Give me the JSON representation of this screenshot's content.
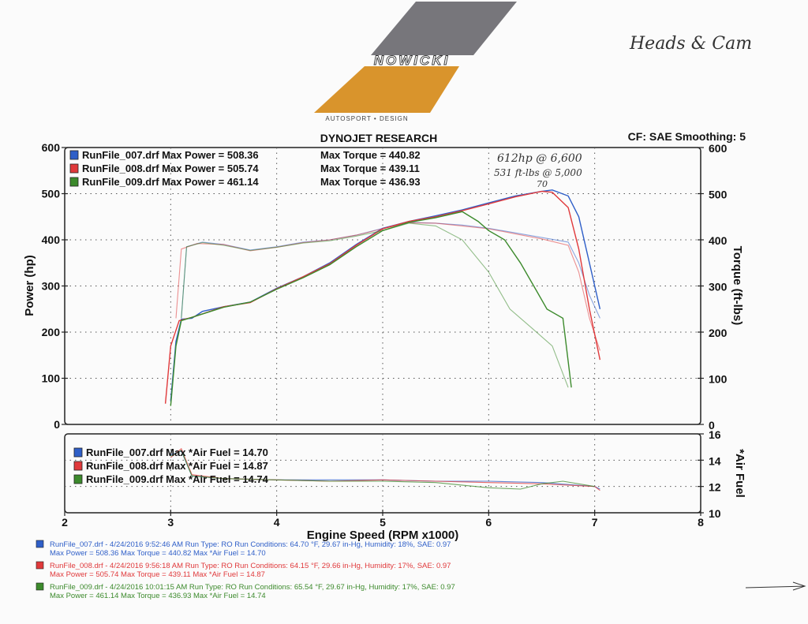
{
  "logo": {
    "brand": "NOWICKI",
    "tagline": "AUTOSPORT • DESIGN",
    "colors": {
      "gray": "#77767b",
      "orange": "#d9942c"
    }
  },
  "handwritten": {
    "top_right": "Heads & Cam",
    "note_line1": "612hp @ 6,600",
    "note_line2": "531 ft-lbs @ 5,000",
    "note_line3": "70"
  },
  "chart_data": {
    "type": "line",
    "title": "DYNOJET RESEARCH",
    "subtitle": "CF: SAE  Smoothing: 5",
    "xlabel": "Engine Speed (RPM x1000)",
    "ylabel_left": "Power (hp)",
    "ylabel_right": "Torque (ft-lbs)",
    "ylabel_lower": "*Air Fuel",
    "xlim": [
      2,
      8
    ],
    "ylim_upper": [
      0,
      600
    ],
    "ylim_lower": [
      10,
      16
    ],
    "x_ticks": [
      "2",
      "3",
      "4",
      "5",
      "6",
      "7",
      "8"
    ],
    "y_ticks_left": [
      "0",
      "100",
      "200",
      "300",
      "400",
      "500",
      "600"
    ],
    "y_ticks_right": [
      "0",
      "100",
      "200",
      "300",
      "400",
      "500",
      "600"
    ],
    "y_ticks_lower": [
      "10",
      "12",
      "14",
      "16"
    ],
    "grid": true,
    "legend_upper": [
      {
        "label": "RunFile_007.drf Max Power = 508.36",
        "torque": "Max Torque = 440.82",
        "color": "#2f5fc8"
      },
      {
        "label": "RunFile_008.drf Max Power = 505.74",
        "torque": "Max Torque = 439.11",
        "color": "#e0393b"
      },
      {
        "label": "RunFile_009.drf Max Power = 461.14",
        "torque": "Max Torque = 436.93",
        "color": "#3c8a2c"
      }
    ],
    "legend_lower": [
      {
        "label": "RunFile_007.drf Max *Air Fuel = 14.70",
        "color": "#2f5fc8"
      },
      {
        "label": "RunFile_008.drf Max *Air Fuel = 14.87",
        "color": "#e0393b"
      },
      {
        "label": "RunFile_009.drf Max *Air Fuel = 14.74",
        "color": "#3c8a2c"
      }
    ],
    "series": [
      {
        "name": "RunFile_007.drf",
        "color": "#2f5fc8",
        "power": [
          [
            3.0,
            50
          ],
          [
            3.05,
            180
          ],
          [
            3.1,
            228
          ],
          [
            3.2,
            230
          ],
          [
            3.3,
            245
          ],
          [
            3.5,
            255
          ],
          [
            3.75,
            265
          ],
          [
            4.0,
            295
          ],
          [
            4.25,
            320
          ],
          [
            4.5,
            350
          ],
          [
            4.75,
            390
          ],
          [
            5.0,
            425
          ],
          [
            5.25,
            440
          ],
          [
            5.5,
            452
          ],
          [
            5.75,
            465
          ],
          [
            6.0,
            480
          ],
          [
            6.25,
            495
          ],
          [
            6.5,
            505
          ],
          [
            6.6,
            508
          ],
          [
            6.75,
            495
          ],
          [
            6.85,
            450
          ],
          [
            6.95,
            350
          ],
          [
            7.05,
            250
          ]
        ],
        "torque": [
          [
            3.1,
            230
          ],
          [
            3.15,
            385
          ],
          [
            3.3,
            395
          ],
          [
            3.5,
            390
          ],
          [
            3.75,
            378
          ],
          [
            4.0,
            385
          ],
          [
            4.25,
            395
          ],
          [
            4.5,
            400
          ],
          [
            4.75,
            410
          ],
          [
            5.0,
            425
          ],
          [
            5.25,
            438
          ],
          [
            5.5,
            436
          ],
          [
            5.75,
            432
          ],
          [
            6.0,
            425
          ],
          [
            6.25,
            415
          ],
          [
            6.5,
            405
          ],
          [
            6.75,
            395
          ],
          [
            6.85,
            350
          ],
          [
            6.95,
            280
          ],
          [
            7.05,
            230
          ]
        ],
        "air_fuel": [
          [
            3.0,
            14.4
          ],
          [
            3.1,
            14.7
          ],
          [
            3.2,
            12.8
          ],
          [
            3.5,
            12.6
          ],
          [
            4.0,
            12.5
          ],
          [
            4.5,
            12.5
          ],
          [
            5.0,
            12.5
          ],
          [
            5.5,
            12.4
          ],
          [
            6.0,
            12.4
          ],
          [
            6.5,
            12.3
          ],
          [
            7.0,
            12.0
          ],
          [
            7.05,
            11.8
          ]
        ]
      },
      {
        "name": "RunFile_008.drf",
        "color": "#e0393b",
        "power": [
          [
            2.95,
            45
          ],
          [
            3.0,
            170
          ],
          [
            3.08,
            225
          ],
          [
            3.2,
            232
          ],
          [
            3.5,
            255
          ],
          [
            3.75,
            264
          ],
          [
            4.0,
            294
          ],
          [
            4.25,
            320
          ],
          [
            4.5,
            348
          ],
          [
            4.75,
            388
          ],
          [
            5.0,
            424
          ],
          [
            5.25,
            440
          ],
          [
            5.5,
            450
          ],
          [
            5.75,
            463
          ],
          [
            6.0,
            478
          ],
          [
            6.25,
            493
          ],
          [
            6.5,
            505
          ],
          [
            6.6,
            503
          ],
          [
            6.75,
            470
          ],
          [
            6.85,
            380
          ],
          [
            6.95,
            250
          ],
          [
            7.05,
            140
          ]
        ],
        "torque": [
          [
            3.05,
            230
          ],
          [
            3.1,
            380
          ],
          [
            3.25,
            392
          ],
          [
            3.5,
            390
          ],
          [
            3.75,
            376
          ],
          [
            4.0,
            384
          ],
          [
            4.25,
            394
          ],
          [
            4.5,
            400
          ],
          [
            4.75,
            410
          ],
          [
            5.0,
            424
          ],
          [
            5.25,
            437
          ],
          [
            5.5,
            436
          ],
          [
            5.75,
            430
          ],
          [
            6.0,
            424
          ],
          [
            6.25,
            413
          ],
          [
            6.5,
            402
          ],
          [
            6.75,
            388
          ],
          [
            6.85,
            330
          ],
          [
            6.95,
            230
          ],
          [
            7.05,
            160
          ]
        ],
        "air_fuel": [
          [
            3.0,
            14.2
          ],
          [
            3.1,
            14.87
          ],
          [
            3.2,
            12.9
          ],
          [
            3.5,
            12.6
          ],
          [
            4.0,
            12.5
          ],
          [
            4.5,
            12.4
          ],
          [
            5.0,
            12.5
          ],
          [
            5.5,
            12.4
          ],
          [
            6.0,
            12.3
          ],
          [
            6.5,
            12.2
          ],
          [
            7.0,
            12.0
          ],
          [
            7.05,
            11.7
          ]
        ]
      },
      {
        "name": "RunFile_009.drf",
        "color": "#3c8a2c",
        "power": [
          [
            3.0,
            40
          ],
          [
            3.05,
            170
          ],
          [
            3.1,
            225
          ],
          [
            3.2,
            232
          ],
          [
            3.5,
            254
          ],
          [
            3.75,
            265
          ],
          [
            4.0,
            293
          ],
          [
            4.25,
            318
          ],
          [
            4.5,
            346
          ],
          [
            4.75,
            385
          ],
          [
            5.0,
            420
          ],
          [
            5.25,
            438
          ],
          [
            5.5,
            448
          ],
          [
            5.75,
            461
          ],
          [
            5.9,
            440
          ],
          [
            6.0,
            420
          ],
          [
            6.15,
            400
          ],
          [
            6.3,
            350
          ],
          [
            6.45,
            290
          ],
          [
            6.55,
            250
          ],
          [
            6.7,
            230
          ],
          [
            6.78,
            80
          ]
        ],
        "torque": [
          [
            3.1,
            230
          ],
          [
            3.15,
            385
          ],
          [
            3.3,
            394
          ],
          [
            3.5,
            388
          ],
          [
            3.75,
            377
          ],
          [
            4.0,
            384
          ],
          [
            4.25,
            393
          ],
          [
            4.5,
            398
          ],
          [
            4.75,
            408
          ],
          [
            5.0,
            420
          ],
          [
            5.25,
            436
          ],
          [
            5.5,
            430
          ],
          [
            5.75,
            400
          ],
          [
            6.0,
            330
          ],
          [
            6.2,
            250
          ],
          [
            6.4,
            210
          ],
          [
            6.6,
            170
          ],
          [
            6.75,
            80
          ]
        ],
        "air_fuel": [
          [
            3.0,
            14.3
          ],
          [
            3.1,
            14.74
          ],
          [
            3.2,
            12.8
          ],
          [
            3.5,
            12.6
          ],
          [
            4.0,
            12.5
          ],
          [
            4.5,
            12.4
          ],
          [
            5.0,
            12.4
          ],
          [
            5.5,
            12.3
          ],
          [
            6.0,
            11.9
          ],
          [
            6.3,
            11.8
          ],
          [
            6.5,
            12.2
          ],
          [
            6.7,
            12.4
          ],
          [
            7.0,
            12.0
          ]
        ]
      }
    ],
    "run_info": [
      {
        "line1": "RunFile_007.drf - 4/24/2016 9:52:46 AM  Run Type: RO  Run Conditions: 64.70 °F, 29.67 in-Hg,  Humidity:  18%, SAE: 0.97",
        "line2": "Max Power = 508.36   Max Torque = 440.82   Max *Air Fuel = 14.70",
        "color": "#2f5fc8"
      },
      {
        "line1": "RunFile_008.drf - 4/24/2016 9:56:18 AM  Run Type: RO  Run Conditions: 64.15 °F, 29.66 in-Hg,  Humidity:  17%, SAE: 0.97",
        "line2": "Max Power = 505.74   Max Torque = 439.11   Max *Air Fuel = 14.87",
        "color": "#e0393b"
      },
      {
        "line1": "RunFile_009.drf - 4/24/2016 10:01:15 AM  Run Type: RO  Run Conditions: 65.54 °F, 29.67 in-Hg,  Humidity:  17%, SAE: 0.97",
        "line2": "Max Power = 461.14   Max Torque = 436.93   Max *Air Fuel = 14.74",
        "color": "#3c8a2c"
      }
    ]
  }
}
